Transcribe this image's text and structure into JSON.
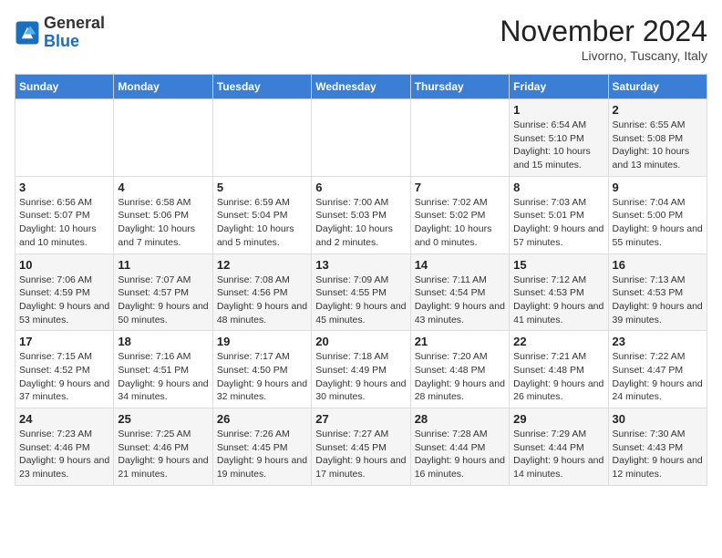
{
  "header": {
    "logo_general": "General",
    "logo_blue": "Blue",
    "month_title": "November 2024",
    "subtitle": "Livorno, Tuscany, Italy"
  },
  "days_of_week": [
    "Sunday",
    "Monday",
    "Tuesday",
    "Wednesday",
    "Thursday",
    "Friday",
    "Saturday"
  ],
  "weeks": [
    [
      {
        "day": "",
        "detail": ""
      },
      {
        "day": "",
        "detail": ""
      },
      {
        "day": "",
        "detail": ""
      },
      {
        "day": "",
        "detail": ""
      },
      {
        "day": "",
        "detail": ""
      },
      {
        "day": "1",
        "detail": "Sunrise: 6:54 AM\nSunset: 5:10 PM\nDaylight: 10 hours and 15 minutes."
      },
      {
        "day": "2",
        "detail": "Sunrise: 6:55 AM\nSunset: 5:08 PM\nDaylight: 10 hours and 13 minutes."
      }
    ],
    [
      {
        "day": "3",
        "detail": "Sunrise: 6:56 AM\nSunset: 5:07 PM\nDaylight: 10 hours and 10 minutes."
      },
      {
        "day": "4",
        "detail": "Sunrise: 6:58 AM\nSunset: 5:06 PM\nDaylight: 10 hours and 7 minutes."
      },
      {
        "day": "5",
        "detail": "Sunrise: 6:59 AM\nSunset: 5:04 PM\nDaylight: 10 hours and 5 minutes."
      },
      {
        "day": "6",
        "detail": "Sunrise: 7:00 AM\nSunset: 5:03 PM\nDaylight: 10 hours and 2 minutes."
      },
      {
        "day": "7",
        "detail": "Sunrise: 7:02 AM\nSunset: 5:02 PM\nDaylight: 10 hours and 0 minutes."
      },
      {
        "day": "8",
        "detail": "Sunrise: 7:03 AM\nSunset: 5:01 PM\nDaylight: 9 hours and 57 minutes."
      },
      {
        "day": "9",
        "detail": "Sunrise: 7:04 AM\nSunset: 5:00 PM\nDaylight: 9 hours and 55 minutes."
      }
    ],
    [
      {
        "day": "10",
        "detail": "Sunrise: 7:06 AM\nSunset: 4:59 PM\nDaylight: 9 hours and 53 minutes."
      },
      {
        "day": "11",
        "detail": "Sunrise: 7:07 AM\nSunset: 4:57 PM\nDaylight: 9 hours and 50 minutes."
      },
      {
        "day": "12",
        "detail": "Sunrise: 7:08 AM\nSunset: 4:56 PM\nDaylight: 9 hours and 48 minutes."
      },
      {
        "day": "13",
        "detail": "Sunrise: 7:09 AM\nSunset: 4:55 PM\nDaylight: 9 hours and 45 minutes."
      },
      {
        "day": "14",
        "detail": "Sunrise: 7:11 AM\nSunset: 4:54 PM\nDaylight: 9 hours and 43 minutes."
      },
      {
        "day": "15",
        "detail": "Sunrise: 7:12 AM\nSunset: 4:53 PM\nDaylight: 9 hours and 41 minutes."
      },
      {
        "day": "16",
        "detail": "Sunrise: 7:13 AM\nSunset: 4:53 PM\nDaylight: 9 hours and 39 minutes."
      }
    ],
    [
      {
        "day": "17",
        "detail": "Sunrise: 7:15 AM\nSunset: 4:52 PM\nDaylight: 9 hours and 37 minutes."
      },
      {
        "day": "18",
        "detail": "Sunrise: 7:16 AM\nSunset: 4:51 PM\nDaylight: 9 hours and 34 minutes."
      },
      {
        "day": "19",
        "detail": "Sunrise: 7:17 AM\nSunset: 4:50 PM\nDaylight: 9 hours and 32 minutes."
      },
      {
        "day": "20",
        "detail": "Sunrise: 7:18 AM\nSunset: 4:49 PM\nDaylight: 9 hours and 30 minutes."
      },
      {
        "day": "21",
        "detail": "Sunrise: 7:20 AM\nSunset: 4:48 PM\nDaylight: 9 hours and 28 minutes."
      },
      {
        "day": "22",
        "detail": "Sunrise: 7:21 AM\nSunset: 4:48 PM\nDaylight: 9 hours and 26 minutes."
      },
      {
        "day": "23",
        "detail": "Sunrise: 7:22 AM\nSunset: 4:47 PM\nDaylight: 9 hours and 24 minutes."
      }
    ],
    [
      {
        "day": "24",
        "detail": "Sunrise: 7:23 AM\nSunset: 4:46 PM\nDaylight: 9 hours and 23 minutes."
      },
      {
        "day": "25",
        "detail": "Sunrise: 7:25 AM\nSunset: 4:46 PM\nDaylight: 9 hours and 21 minutes."
      },
      {
        "day": "26",
        "detail": "Sunrise: 7:26 AM\nSunset: 4:45 PM\nDaylight: 9 hours and 19 minutes."
      },
      {
        "day": "27",
        "detail": "Sunrise: 7:27 AM\nSunset: 4:45 PM\nDaylight: 9 hours and 17 minutes."
      },
      {
        "day": "28",
        "detail": "Sunrise: 7:28 AM\nSunset: 4:44 PM\nDaylight: 9 hours and 16 minutes."
      },
      {
        "day": "29",
        "detail": "Sunrise: 7:29 AM\nSunset: 4:44 PM\nDaylight: 9 hours and 14 minutes."
      },
      {
        "day": "30",
        "detail": "Sunrise: 7:30 AM\nSunset: 4:43 PM\nDaylight: 9 hours and 12 minutes."
      }
    ]
  ]
}
